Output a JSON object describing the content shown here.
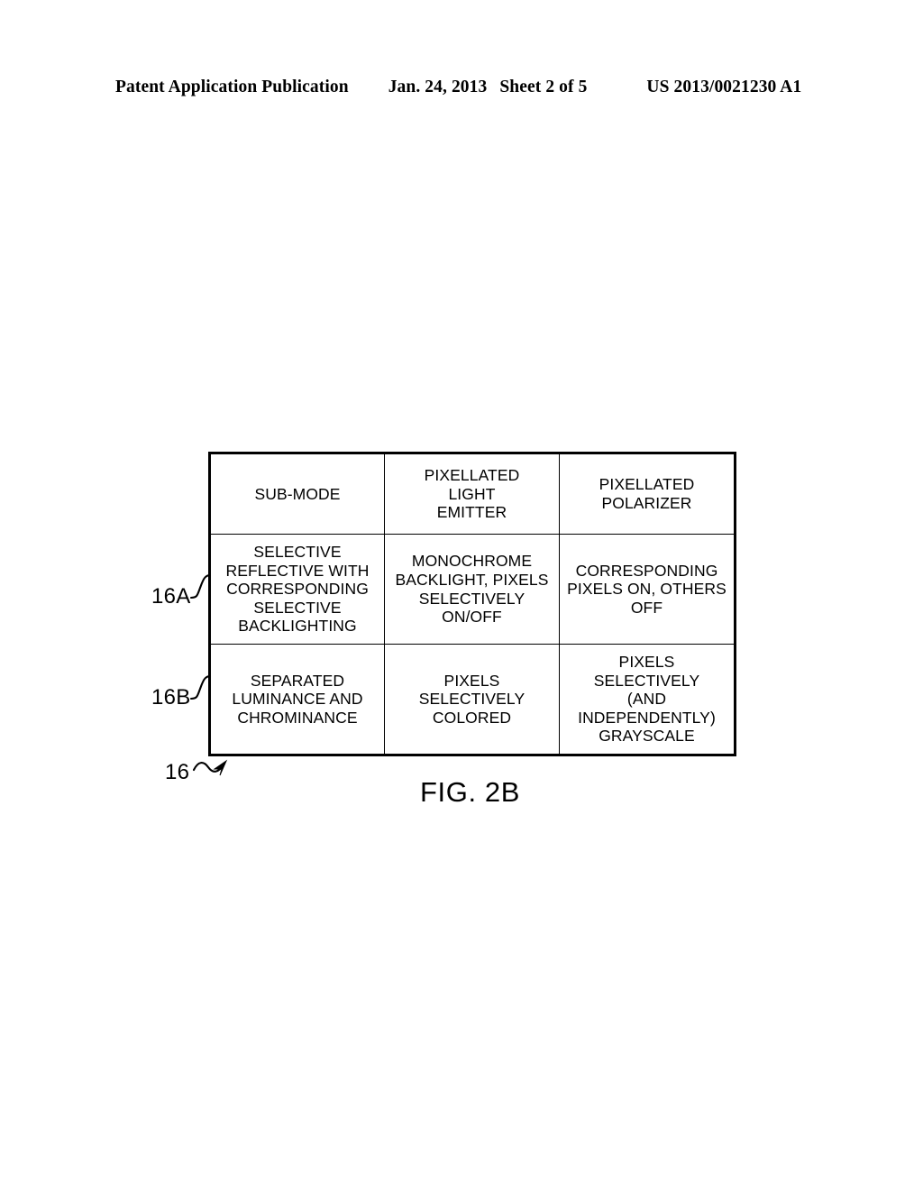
{
  "header": {
    "publication": "Patent Application Publication",
    "date": "Jan. 24, 2013",
    "sheet": "Sheet 2 of 5",
    "pub_number": "US 2013/0021230 A1"
  },
  "figure": {
    "caption": "FIG. 2B",
    "callouts": {
      "table": "16",
      "row_a": "16A",
      "row_b": "16B"
    }
  },
  "table": {
    "columns": [
      "SUB-MODE",
      "PIXELLATED LIGHT EMITTER",
      "PIXELLATED POLARIZER"
    ],
    "header_lines": [
      [
        "SUB-MODE"
      ],
      [
        "PIXELLATED",
        "LIGHT",
        "EMITTER"
      ],
      [
        "PIXELLATED",
        "POLARIZER"
      ]
    ],
    "rows": [
      {
        "ref": "16A",
        "cells_lines": [
          [
            "SELECTIVE",
            "REFLECTIVE WITH",
            "CORRESPONDING",
            "SELECTIVE",
            "BACKLIGHTING"
          ],
          [
            "MONOCHROME",
            "BACKLIGHT, PIXELS",
            "SELECTIVELY",
            "ON/OFF"
          ],
          [
            "CORRESPONDING",
            "PIXELS ON, OTHERS",
            "OFF"
          ]
        ],
        "cells_text": [
          "SELECTIVE REFLECTIVE WITH CORRESPONDING SELECTIVE BACKLIGHTING",
          "MONOCHROME BACKLIGHT, PIXELS SELECTIVELY ON/OFF",
          "CORRESPONDING PIXELS ON, OTHERS OFF"
        ]
      },
      {
        "ref": "16B",
        "cells_lines": [
          [
            "SEPARATED",
            "LUMINANCE AND",
            "CHROMINANCE"
          ],
          [
            "PIXELS",
            "SELECTIVELY",
            "COLORED"
          ],
          [
            "PIXELS",
            "SELECTIVELY",
            "(AND",
            "INDEPENDENTLY)",
            "GRAYSCALE"
          ]
        ],
        "cells_text": [
          "SEPARATED LUMINANCE AND CHROMINANCE",
          "PIXELS SELECTIVELY COLORED",
          "PIXELS SELECTIVELY (AND INDEPENDENTLY) GRAYSCALE"
        ]
      }
    ]
  },
  "colors": {
    "ink": "#000000",
    "paper": "#ffffff"
  }
}
